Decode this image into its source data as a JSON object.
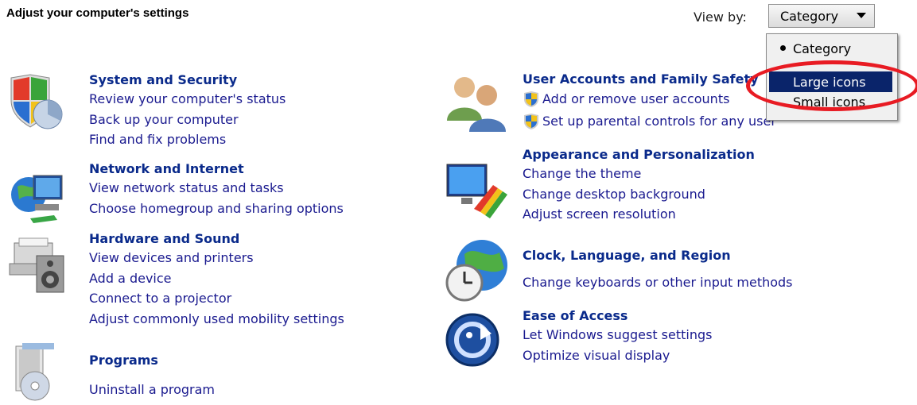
{
  "header": {
    "title": "Adjust your computer's settings",
    "view_by_label": "View by:",
    "view_by_value": "Category"
  },
  "view_menu": {
    "options": [
      "Category",
      "Large icons",
      "Small icons"
    ],
    "selected": "Category",
    "highlighted": "Large icons"
  },
  "left_categories": [
    {
      "title": "System and Security",
      "icon": "system-security-icon",
      "links": [
        "Review your computer's status",
        "Back up your computer",
        "Find and fix problems"
      ]
    },
    {
      "title": "Network and Internet",
      "icon": "network-icon",
      "links": [
        "View network status and tasks",
        "Choose homegroup and sharing options"
      ]
    },
    {
      "title": "Hardware and Sound",
      "icon": "hardware-sound-icon",
      "links": [
        "View devices and printers",
        "Add a device",
        "Connect to a projector",
        "Adjust commonly used mobility settings"
      ]
    },
    {
      "title": "Programs",
      "icon": "programs-icon",
      "links": [
        "Uninstall a program"
      ]
    }
  ],
  "right_categories": [
    {
      "title": "User Accounts and Family Safety",
      "icon": "user-accounts-icon",
      "links": [
        "Add or remove user accounts",
        "Set up parental controls for any user"
      ]
    },
    {
      "title": "Appearance and Personalization",
      "icon": "appearance-icon",
      "links": [
        "Change the theme",
        "Change desktop background",
        "Adjust screen resolution"
      ]
    },
    {
      "title": "Clock, Language, and Region",
      "icon": "clock-globe-icon",
      "links": [
        "Change keyboards or other input methods"
      ]
    },
    {
      "title": "Ease of Access",
      "icon": "ease-of-access-icon",
      "links": [
        "Let Windows suggest settings",
        "Optimize visual display"
      ]
    }
  ],
  "colors": {
    "link": "#1a1a8f",
    "title": "#0a2a8b",
    "menu_highlight": "#0a246a",
    "annotation": "#e81b23"
  }
}
